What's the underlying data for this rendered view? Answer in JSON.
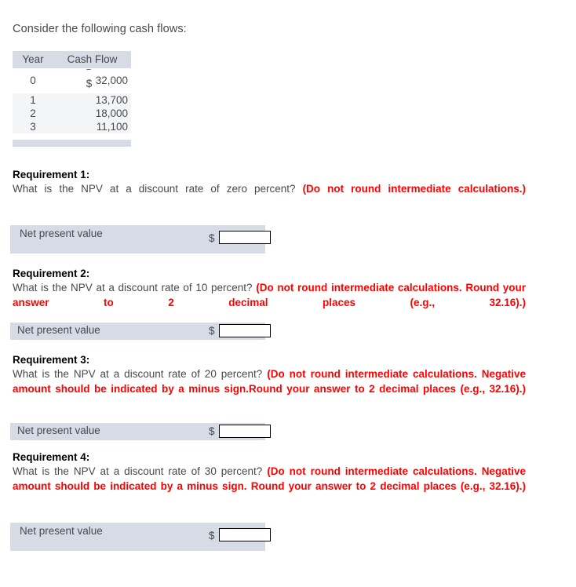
{
  "intro": "Consider the following cash flows:",
  "cash_flow_table": {
    "headers": [
      "Year",
      "Cash Flow"
    ],
    "rows": [
      {
        "year": "0",
        "currency": "$",
        "sign": "‾",
        "amount": "32,000",
        "display": "−$32,000"
      },
      {
        "year": "1",
        "amount": "13,700"
      },
      {
        "year": "2",
        "amount": "18,000"
      },
      {
        "year": "3",
        "amount": "11,100"
      }
    ]
  },
  "requirements": [
    {
      "title": "Requirement 1:",
      "question": "What is the NPV at a discount rate of zero percent? ",
      "hint": "(Do not round intermediate calculations.)",
      "answer_label": "Net present value",
      "currency_symbol": "$",
      "answer_value": "",
      "answer_placeholder": ""
    },
    {
      "title": "Requirement 2:",
      "question": "What is the NPV at a discount rate of 10 percent? ",
      "hint": "(Do not round intermediate calculations. Round your answer to 2 decimal places (e.g., 32.16).)",
      "answer_label": "Net present value",
      "currency_symbol": "$",
      "answer_value": "",
      "answer_placeholder": ""
    },
    {
      "title": "Requirement 3:",
      "question": "What is the NPV at a discount rate of 20 percent? ",
      "hint": "(Do not round intermediate calculations. Negative amount should be indicated by a minus sign.Round your answer to 2 decimal places (e.g., 32.16).)",
      "answer_label": "Net present value",
      "currency_symbol": "$",
      "answer_value": "",
      "answer_placeholder": ""
    },
    {
      "title": "Requirement 4:",
      "question": "What is the NPV at a discount rate of 30 percent? ",
      "hint": "(Do not round intermediate calculations. Negative amount should be indicated by a minus sign. Round your answer to 2 decimal places (e.g., 32.16).)",
      "answer_label": "Net present value",
      "currency_symbol": "$",
      "answer_value": "",
      "answer_placeholder": ""
    }
  ],
  "colors": {
    "hint_red": "#ff0000",
    "panel_blue_gray": "#d6dbe6",
    "row_stripe": "#f4f5f7",
    "body_text": "#46494f"
  }
}
